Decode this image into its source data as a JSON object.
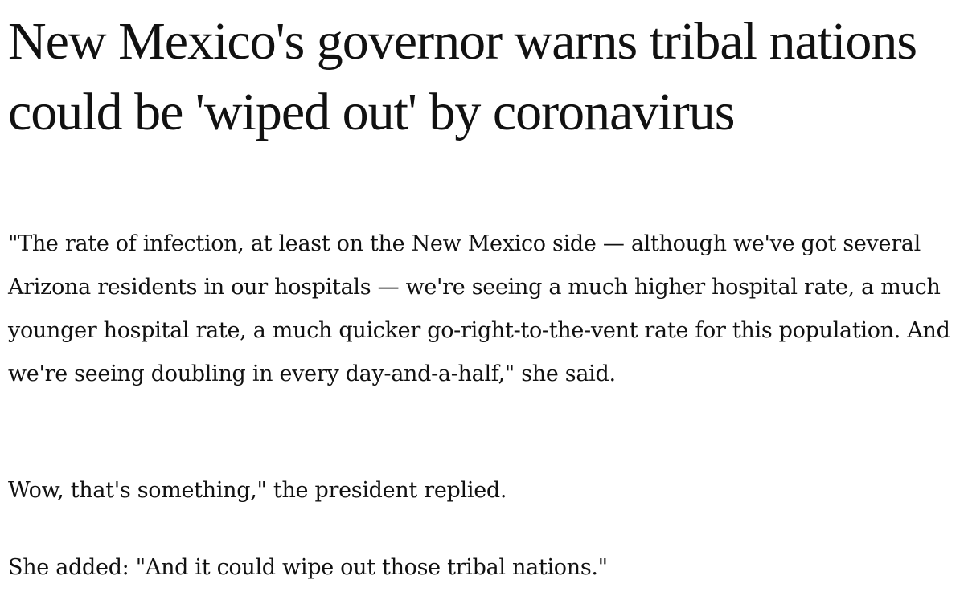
{
  "article": {
    "headline": "New Mexico's governor warns tribal nations could be 'wiped out' by coronavirus",
    "paragraphs": [
      "\"The rate of infection, at least on the New Mexico side — although we've got several Arizona residents in our hospitals — we're seeing a much higher hospital rate, a much younger hospital rate, a much quicker go-right-to-the-vent rate for this population. And we're seeing doubling in every day-and-a-half,\" she said.",
      "Wow, that's something,\" the president replied.",
      "She added: \"And it could wipe out those tribal nations.\""
    ]
  }
}
